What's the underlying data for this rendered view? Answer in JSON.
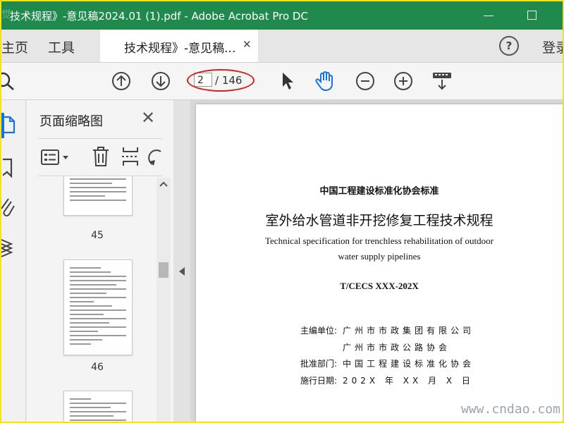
{
  "window": {
    "title": "技术规程》-意见稿2024.01 (1).pdf - Adobe Acrobat Pro DC",
    "corner_watermark": "觉"
  },
  "tabbar": {
    "home": "主页",
    "tools": "工具",
    "doc_tab": "技术规程》-意见稿...",
    "signin": "登录"
  },
  "toolbar": {
    "current_page": "2",
    "page_total": "/ 146"
  },
  "thumbnails": {
    "title": "页面缩略图",
    "pages": [
      "45",
      "46"
    ]
  },
  "document": {
    "org": "中国工程建设标准化协会标准",
    "title": "室外给水管道非开挖修复工程技术规程",
    "en_line1": "Technical specification for trenchless rehabilitation of outdoor",
    "en_line2": "water supply pipelines",
    "code": "T/CECS XXX-202X",
    "rows": [
      {
        "k": "主编单位:",
        "v": "广州市市政集团有限公司"
      },
      {
        "k": "",
        "v": "广州市市政公路协会"
      },
      {
        "k": "批准部门:",
        "v": "中国工程建设标准化协会"
      },
      {
        "k": "施行日期:",
        "v": "202X 年 XX 月 X 日"
      }
    ]
  },
  "watermark": "www.cndao.com",
  "colors": {
    "titlebar": "#1f8a4c",
    "accent": "#1473e6",
    "highlight_ellipse": "#d62020",
    "outer_border": "#f5e21b"
  }
}
